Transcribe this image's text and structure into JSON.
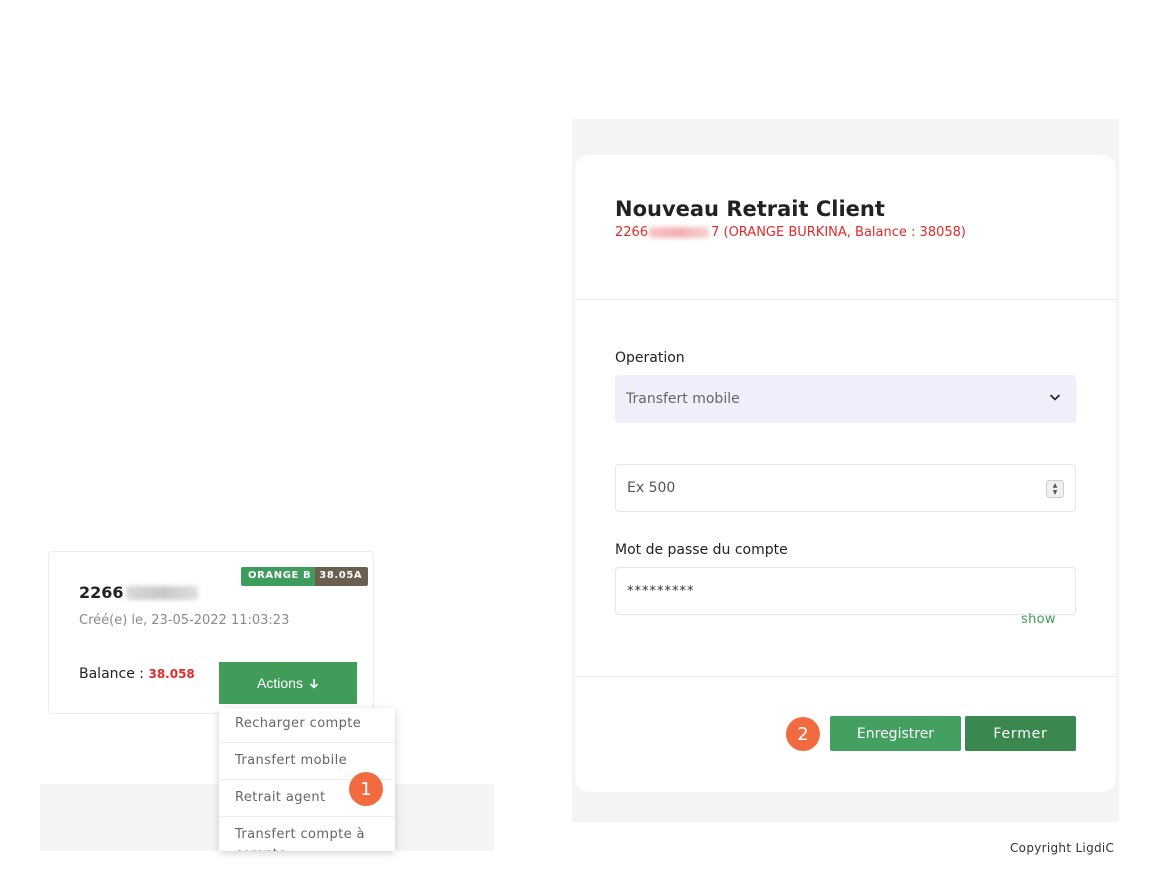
{
  "account_card": {
    "number_prefix": "2266",
    "operator_badge": "ORANGE B",
    "operator_badge_overlap": "38.05A",
    "created": "Créé(e) le, 23-05-2022 11:03:23",
    "balance_label": "Balance :",
    "balance_value": "38.058",
    "actions_label": "Actions",
    "actions_icon": "arrow-down-icon"
  },
  "actions_menu": {
    "items": [
      "Recharger compte",
      "Transfert mobile",
      "Retrait agent",
      "Transfert compte à compte"
    ]
  },
  "markers": {
    "one": "1",
    "two": "2"
  },
  "modal": {
    "title": "Nouveau Retrait Client",
    "subtitle_prefix": "2266",
    "subtitle_suffix": "7 (ORANGE BURKINA, Balance : 38058)",
    "operation_label": "Operation",
    "operation_value": "Transfert mobile",
    "amount_placeholder": "Ex 500",
    "password_label": "Mot de passe du compte",
    "password_value": "*********",
    "show_label": "show",
    "save_label": "Enregistrer",
    "close_label": "Fermer"
  },
  "footer": {
    "copyright": "Copyright LigdiC"
  },
  "colors": {
    "green": "#3f9c59",
    "red": "#e02b2b",
    "marker": "#f26a3f"
  }
}
